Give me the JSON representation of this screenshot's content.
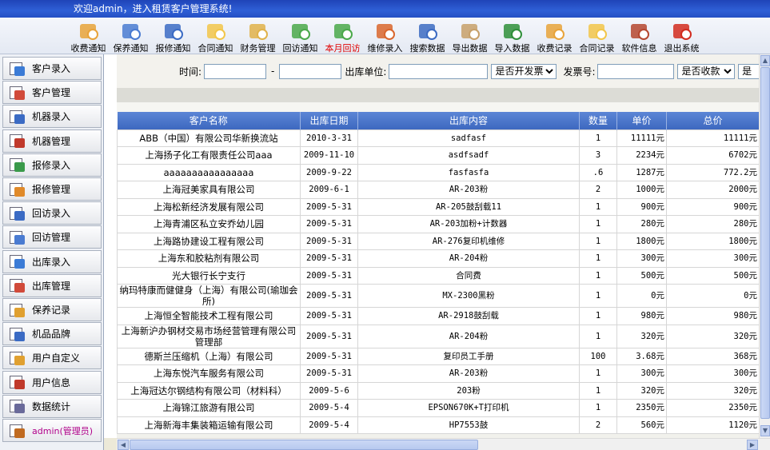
{
  "app": {
    "welcome": "欢迎admin，进入租赁客户管理系统!"
  },
  "toolbar": [
    {
      "label": "收费通知",
      "icon": "fee-notice-icon",
      "color": "#e8a33a"
    },
    {
      "label": "保养通知",
      "icon": "maintenance-notice-icon",
      "color": "#4a7bd1"
    },
    {
      "label": "报修通知",
      "icon": "repair-notice-icon",
      "color": "#3b6bc4"
    },
    {
      "label": "合同通知",
      "icon": "contract-notice-icon",
      "color": "#f2c64a"
    },
    {
      "label": "财务管理",
      "icon": "finance-icon",
      "color": "#e0b24a"
    },
    {
      "label": "回访通知",
      "icon": "revisit-notice-icon",
      "color": "#4aa84a"
    },
    {
      "label": "本月回访",
      "icon": "monthly-revisit-icon",
      "color": "#4aa84a",
      "active": true
    },
    {
      "label": "维修录入",
      "icon": "repair-entry-icon",
      "color": "#d9662d"
    },
    {
      "label": "搜索数据",
      "icon": "search-data-icon",
      "color": "#3c6bc2"
    },
    {
      "label": "导出数据",
      "icon": "export-data-icon",
      "color": "#c7a06a"
    },
    {
      "label": "导入数据",
      "icon": "import-data-icon",
      "color": "#2f8f3a"
    },
    {
      "label": "收费记录",
      "icon": "fee-record-icon",
      "color": "#e8a33a"
    },
    {
      "label": "合同记录",
      "icon": "contract-record-icon",
      "color": "#f2c64a"
    },
    {
      "label": "软件信息",
      "icon": "software-info-icon",
      "color": "#b5472f"
    },
    {
      "label": "退出系统",
      "icon": "exit-icon",
      "color": "#d22b1f"
    }
  ],
  "sidebar": [
    {
      "label": "客户录入",
      "icon": "customer-entry-icon"
    },
    {
      "label": "客户管理",
      "icon": "customer-manage-icon"
    },
    {
      "label": "机器录入",
      "icon": "machine-entry-icon"
    },
    {
      "label": "机器管理",
      "icon": "machine-manage-icon"
    },
    {
      "label": "报修录入",
      "icon": "repair-report-entry-icon"
    },
    {
      "label": "报修管理",
      "icon": "repair-report-manage-icon"
    },
    {
      "label": "回访录入",
      "icon": "revisit-entry-icon"
    },
    {
      "label": "回访管理",
      "icon": "revisit-manage-icon"
    },
    {
      "label": "出库录入",
      "icon": "outbound-entry-icon"
    },
    {
      "label": "出库管理",
      "icon": "outbound-manage-icon"
    },
    {
      "label": "保养记录",
      "icon": "maintenance-record-icon"
    },
    {
      "label": "机品品牌",
      "icon": "brand-icon"
    },
    {
      "label": "用户自定义",
      "icon": "user-custom-icon"
    },
    {
      "label": "用户信息",
      "icon": "user-info-icon"
    },
    {
      "label": "数据统计",
      "icon": "statistics-icon"
    },
    {
      "label": "admin(管理员)",
      "icon": "admin-home-icon",
      "admin": true
    }
  ],
  "filter": {
    "time_label": "时间:",
    "time_from": "",
    "dash": "-",
    "time_to": "",
    "unit_label": "出库单位:",
    "unit_value": "",
    "invoice_select": "是否开发票",
    "invoice_no_label": "发票号:",
    "invoice_no_value": "",
    "paid_select": "是否收款",
    "extra_select": "是"
  },
  "table": {
    "headers": [
      "客户名称",
      "出库日期",
      "出库内容",
      "数量",
      "单价",
      "总价"
    ],
    "rows": [
      [
        "ABB（中国）有限公司华新换流站",
        "2010-3-31",
        "sadfasf",
        "1",
        "11111元",
        "11111元"
      ],
      [
        "上海扬子化工有限责任公司aaa",
        "2009-11-10",
        "asdfsadf",
        "3",
        "2234元",
        "6702元"
      ],
      [
        "aaaaaaaaaaaaaaaa",
        "2009-9-22",
        "fasfasfa",
        ".6",
        "1287元",
        "772.2元"
      ],
      [
        "上海冠美家具有限公司",
        "2009-6-1",
        "AR-203粉",
        "2",
        "1000元",
        "2000元"
      ],
      [
        "上海松新经济发展有限公司",
        "2009-5-31",
        "AR-205鼓刮载11",
        "1",
        "900元",
        "900元"
      ],
      [
        "上海青浦区私立安乔幼儿园",
        "2009-5-31",
        "AR-203加粉+计数器",
        "1",
        "280元",
        "280元"
      ],
      [
        "上海路协建设工程有限公司",
        "2009-5-31",
        "AR-276复印机维修",
        "1",
        "1800元",
        "1800元"
      ],
      [
        "上海东和胶粘剂有限公司",
        "2009-5-31",
        "AR-204粉",
        "1",
        "300元",
        "300元"
      ],
      [
        "光大银行长宁支行",
        "2009-5-31",
        "合同费",
        "1",
        "500元",
        "500元"
      ],
      [
        "纳玛特康而健健身（上海）有限公司(瑜珈会所)",
        "2009-5-31",
        "MX-2300黑粉",
        "1",
        "0元",
        "0元"
      ],
      [
        "上海恒全智能技术工程有限公司",
        "2009-5-31",
        "AR-2918鼓刮载",
        "1",
        "980元",
        "980元"
      ],
      [
        "上海新沪办钢材交易市场经营管理有限公司管理部",
        "2009-5-31",
        "AR-204粉",
        "1",
        "320元",
        "320元"
      ],
      [
        "德斯兰压缩机（上海）有限公司",
        "2009-5-31",
        "复印员工手册",
        "100",
        "3.68元",
        "368元"
      ],
      [
        "上海东悦汽车服务有限公司",
        "2009-5-31",
        "AR-203粉",
        "1",
        "300元",
        "300元"
      ],
      [
        "上海冠达尔钢结构有限公司（材料科）",
        "2009-5-6",
        "203粉",
        "1",
        "320元",
        "320元"
      ],
      [
        "上海锦江旅游有限公司",
        "2009-5-4",
        "EPSON670K+T打印机",
        "1",
        "2350元",
        "2350元"
      ],
      [
        "上海新海丰集装箱运输有限公司",
        "2009-5-4",
        "HP7553鼓",
        "2",
        "560元",
        "1120元"
      ]
    ]
  }
}
